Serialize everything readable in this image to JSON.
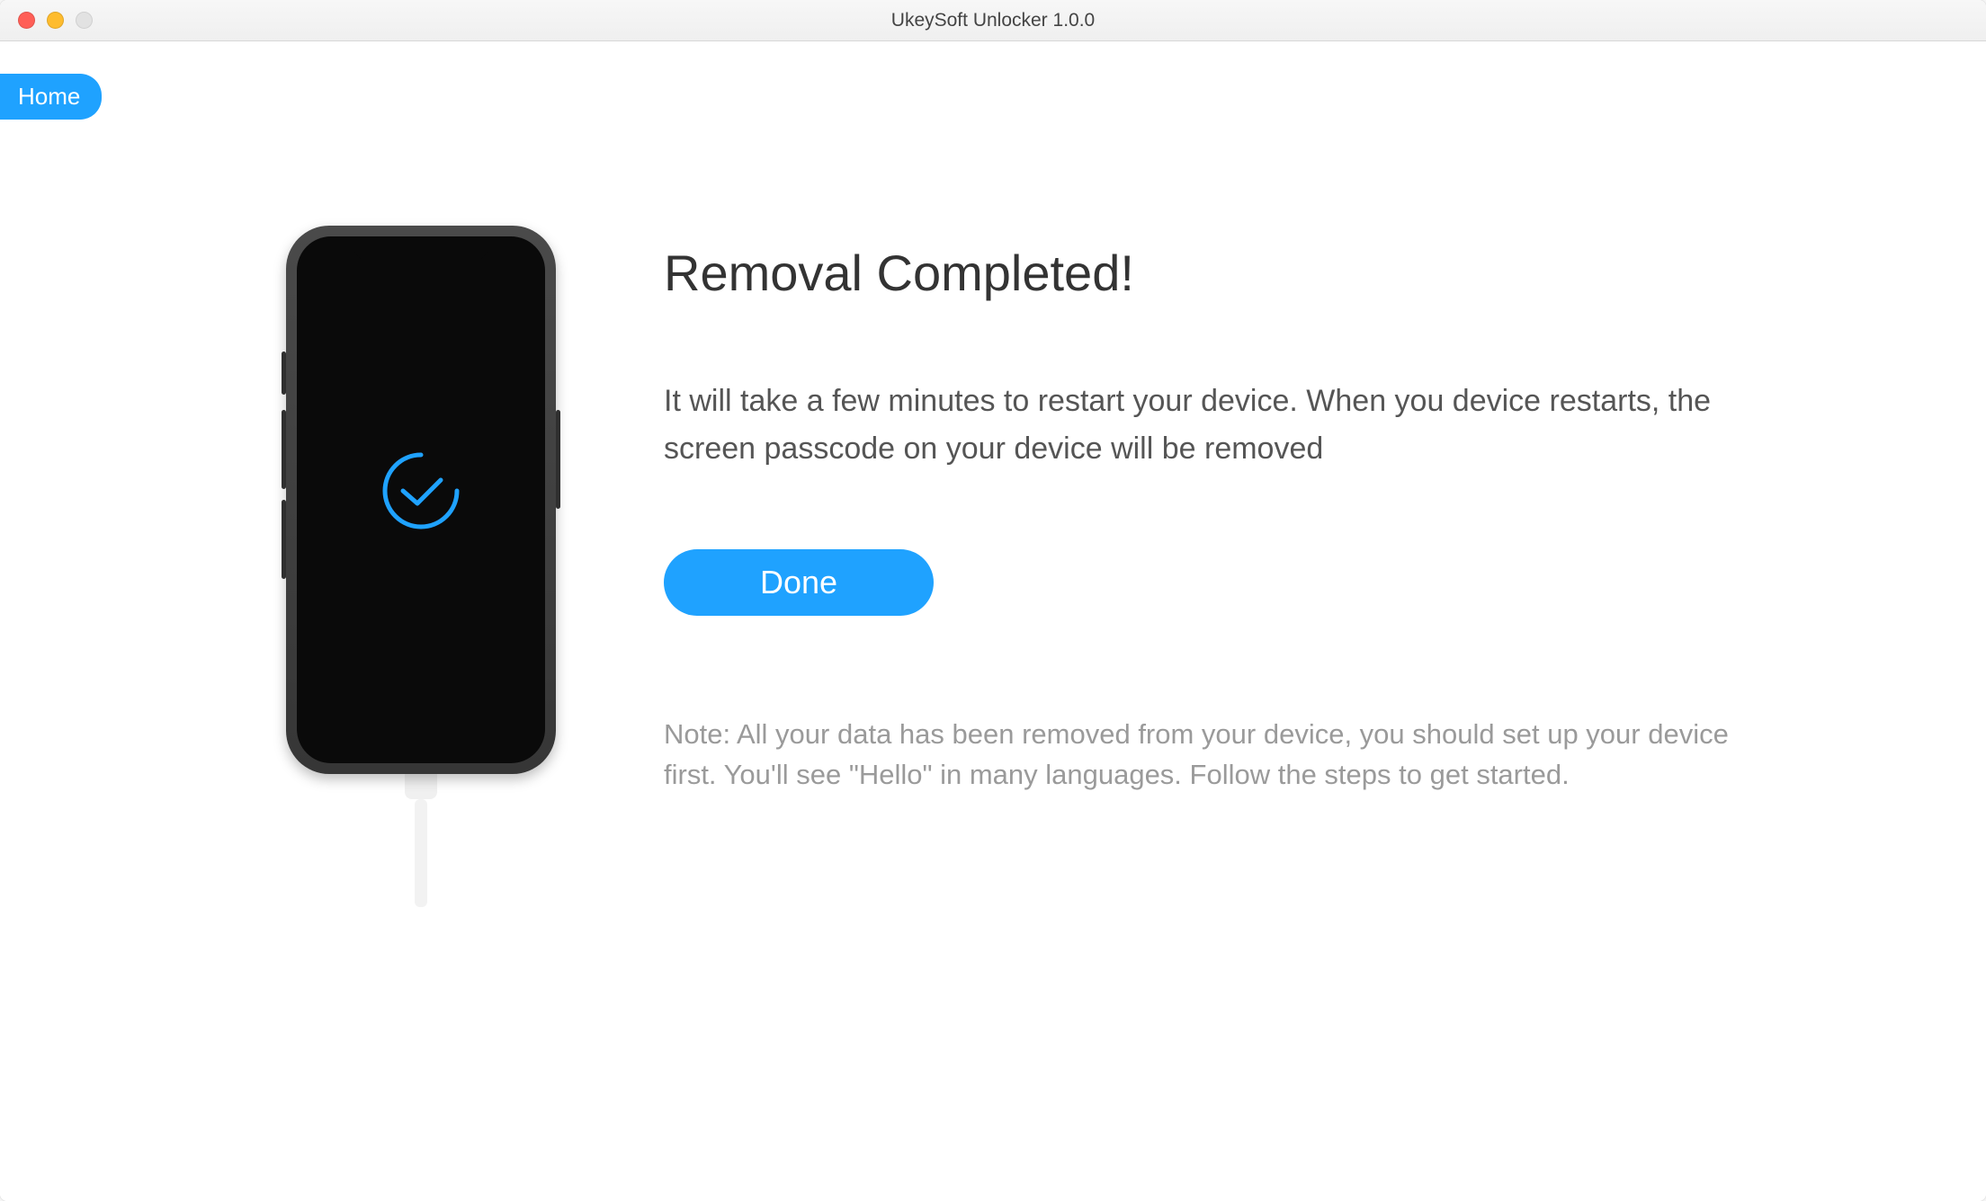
{
  "window": {
    "title": "UkeySoft Unlocker 1.0.0"
  },
  "nav": {
    "home_label": "Home"
  },
  "main": {
    "heading": "Removal Completed!",
    "body": "It will take a few minutes to restart your device. When you device restarts, the screen passcode on your device will be removed",
    "done_label": "Done",
    "note": "Note: All your data has been removed from your device, you should set up your device first. You'll see \"Hello\" in many languages. Follow the steps to get started."
  },
  "icons": {
    "checkmark": "checkmark-circle-icon"
  },
  "colors": {
    "accent": "#1fa2ff",
    "text_dark": "#333333",
    "text_body": "#555555",
    "text_muted": "#9a9a9a"
  }
}
